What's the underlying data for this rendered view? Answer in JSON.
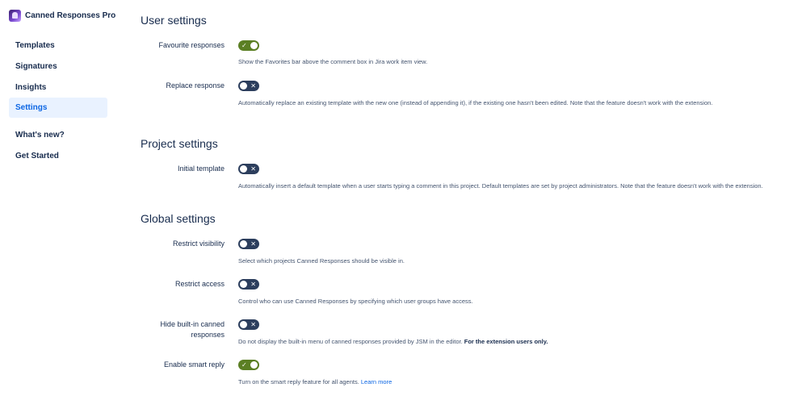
{
  "app": {
    "title": "Canned Responses Pro"
  },
  "sidebar": {
    "items": [
      {
        "label": "Templates"
      },
      {
        "label": "Signatures"
      },
      {
        "label": "Insights"
      },
      {
        "label": "Settings",
        "active": true
      },
      {
        "label": "What's new?"
      },
      {
        "label": "Get Started"
      }
    ]
  },
  "sections": {
    "user": {
      "title": "User settings",
      "favourite": {
        "label": "Favourite responses",
        "enabled": true,
        "desc": "Show the Favorites bar above the comment box in Jira work item view."
      },
      "replace": {
        "label": "Replace response",
        "enabled": false,
        "desc": "Automatically replace an existing template with the new one (instead of appending it), if the existing one hasn't been edited. Note that the feature doesn't work with the extension."
      }
    },
    "project": {
      "title": "Project settings",
      "initial": {
        "label": "Initial template",
        "enabled": false,
        "desc": "Automatically insert a default template when a user starts typing a comment in this project. Default templates are set by project administrators. Note that the feature doesn't work with the extension."
      }
    },
    "global": {
      "title": "Global settings",
      "visibility": {
        "label": "Restrict visibility",
        "enabled": false,
        "desc": "Select which projects Canned Responses should be visible in."
      },
      "access": {
        "label": "Restrict access",
        "enabled": false,
        "desc": "Control who can use Canned Responses by specifying which user groups have access."
      },
      "builtin": {
        "label": "Hide built-in canned responses",
        "enabled": false,
        "desc": "Do not display the built-in menu of canned responses provided by JSM in the editor.",
        "desc_bold": "For the extension users only."
      },
      "smart": {
        "label": "Enable smart reply",
        "enabled": true,
        "desc": "Turn on the smart reply feature for all agents.",
        "link": "Learn more"
      }
    }
  },
  "toggle_glyphs": {
    "on": "✓",
    "off": "✕"
  },
  "colors": {
    "toggle_on": "#5b7f24",
    "toggle_off": "#2c3e5d",
    "nav_active_bg": "#e9f2ff",
    "nav_active_text": "#0c66e4",
    "link": "#0c66e4"
  }
}
